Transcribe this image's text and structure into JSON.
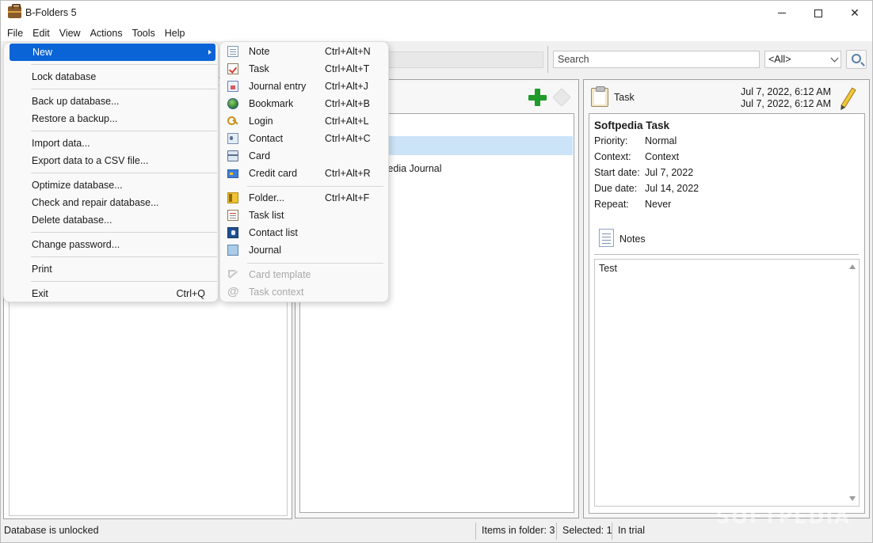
{
  "window": {
    "title": "B-Folders 5",
    "icon": "briefcase-icon"
  },
  "menubar": {
    "items": [
      "File",
      "Edit",
      "View",
      "Actions",
      "Tools",
      "Help"
    ]
  },
  "toolbar": {
    "search_placeholder": "Search",
    "context_value": "<All>",
    "search_icon": "magnifier-icon"
  },
  "file_menu": {
    "items": [
      {
        "label": "New",
        "shortcut": ""
      },
      {
        "label": "Lock database",
        "shortcut": ""
      },
      {
        "label": "Back up database...",
        "shortcut": ""
      },
      {
        "label": "Restore a backup...",
        "shortcut": ""
      },
      {
        "label": "Import data...",
        "shortcut": ""
      },
      {
        "label": "Export data to a CSV file...",
        "shortcut": ""
      },
      {
        "label": "Optimize database...",
        "shortcut": ""
      },
      {
        "label": "Check and repair database...",
        "shortcut": ""
      },
      {
        "label": "Delete database...",
        "shortcut": ""
      },
      {
        "label": "Change password...",
        "shortcut": ""
      },
      {
        "label": "Print",
        "shortcut": ""
      },
      {
        "label": "Exit",
        "shortcut": "Ctrl+Q"
      }
    ]
  },
  "new_submenu": {
    "items": [
      {
        "label": "Note",
        "shortcut": "Ctrl+Alt+N",
        "icon": "note-icon"
      },
      {
        "label": "Task",
        "shortcut": "Ctrl+Alt+T",
        "icon": "task-icon"
      },
      {
        "label": "Journal entry",
        "shortcut": "Ctrl+Alt+J",
        "icon": "journal-entry-icon"
      },
      {
        "label": "Bookmark",
        "shortcut": "Ctrl+Alt+B",
        "icon": "globe-icon"
      },
      {
        "label": "Login",
        "shortcut": "Ctrl+Alt+L",
        "icon": "key-icon"
      },
      {
        "label": "Contact",
        "shortcut": "Ctrl+Alt+C",
        "icon": "contact-card-icon"
      },
      {
        "label": "Card",
        "shortcut": "",
        "icon": "card-icon"
      },
      {
        "label": "Credit card",
        "shortcut": "Ctrl+Alt+R",
        "icon": "credit-card-icon"
      },
      {
        "label": "Folder...",
        "shortcut": "Ctrl+Alt+F",
        "icon": "folder-icon"
      },
      {
        "label": "Task list",
        "shortcut": "",
        "icon": "task-list-icon"
      },
      {
        "label": "Contact list",
        "shortcut": "",
        "icon": "contact-list-icon"
      },
      {
        "label": "Journal",
        "shortcut": "",
        "icon": "journal-icon"
      },
      {
        "label": "Card template",
        "shortcut": "",
        "icon": "template-icon"
      },
      {
        "label": "Task context",
        "shortcut": "",
        "icon": "at-icon"
      }
    ]
  },
  "item_list": {
    "visible_text": "tpedia Journal"
  },
  "detail": {
    "type": "Task",
    "date_created": "Jul 7, 2022, 6:12 AM",
    "date_modified": "Jul 7, 2022, 6:12 AM",
    "title": "Softpedia Task",
    "properties": [
      {
        "label": "Priority:",
        "value": "Normal"
      },
      {
        "label": "Context:",
        "value": "Context"
      },
      {
        "label": "Start date:",
        "value": "Jul 7, 2022"
      },
      {
        "label": "Due date:",
        "value": "Jul 14, 2022"
      },
      {
        "label": "Repeat:",
        "value": "Never"
      }
    ],
    "notes_label": "Notes",
    "notes_text": "Test"
  },
  "statusbar": {
    "lock_status": "Database is unlocked",
    "items_in_folder": "Items in folder: 3",
    "selected": "Selected: 1",
    "license": "In trial"
  },
  "watermark": "SOFTPEDIA",
  "colors": {
    "menu_highlight": "#0a64d6",
    "selection": "#cce4f7",
    "add_green": "#1e9b2a"
  }
}
